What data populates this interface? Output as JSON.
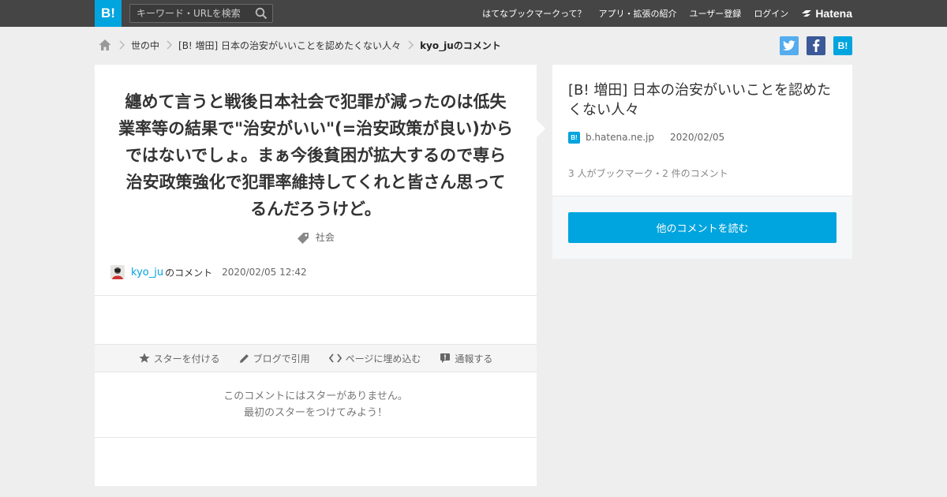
{
  "header": {
    "logo": "B!",
    "search_placeholder": "キーワード・URLを検索",
    "nav": [
      "はてなブックマークって？",
      "アプリ・拡張の紹介",
      "ユーザー登録",
      "ログイン"
    ],
    "hatena_logo": "Hatena"
  },
  "breadcrumb": {
    "items": [
      "世の中",
      "[B! 増田] 日本の治安がいいことを認めたくない人々",
      "kyo_juのコメント"
    ]
  },
  "share": {
    "twitter": "t",
    "facebook": "f",
    "hatena": "B!"
  },
  "comment": {
    "text": "纏めて言うと戦後日本社会で犯罪が減ったのは低失業率等の結果で\"治安がいい\"(=治安政策が良い)からではないでしょ。まぁ今後貧困が拡大するので専ら治安政策強化で犯罪率維持してくれと皆さん思ってるんだろうけど。",
    "tag": "社会",
    "author": "kyo_ju",
    "author_suffix": "のコメント",
    "date": "2020/02/05 12:42"
  },
  "actions": {
    "star": "スターを付ける",
    "blog": "ブログで引用",
    "embed": "ページに埋め込む",
    "report": "通報する"
  },
  "stars": {
    "line1": "このコメントにはスターがありません。",
    "line2": "最初のスターをつけてみよう！"
  },
  "entry": {
    "title": "[B! 増田] 日本の治安がいいことを認めたくない人々",
    "favicon": "B!",
    "domain": "b.hatena.ne.jp",
    "date": "2020/02/05",
    "stats": "3 人がブックマーク・2 件のコメント",
    "read_button": "他のコメントを読む"
  },
  "colors": {
    "brand": "#00a4de",
    "header_bg": "#454545",
    "page_bg": "#eeeeee"
  }
}
